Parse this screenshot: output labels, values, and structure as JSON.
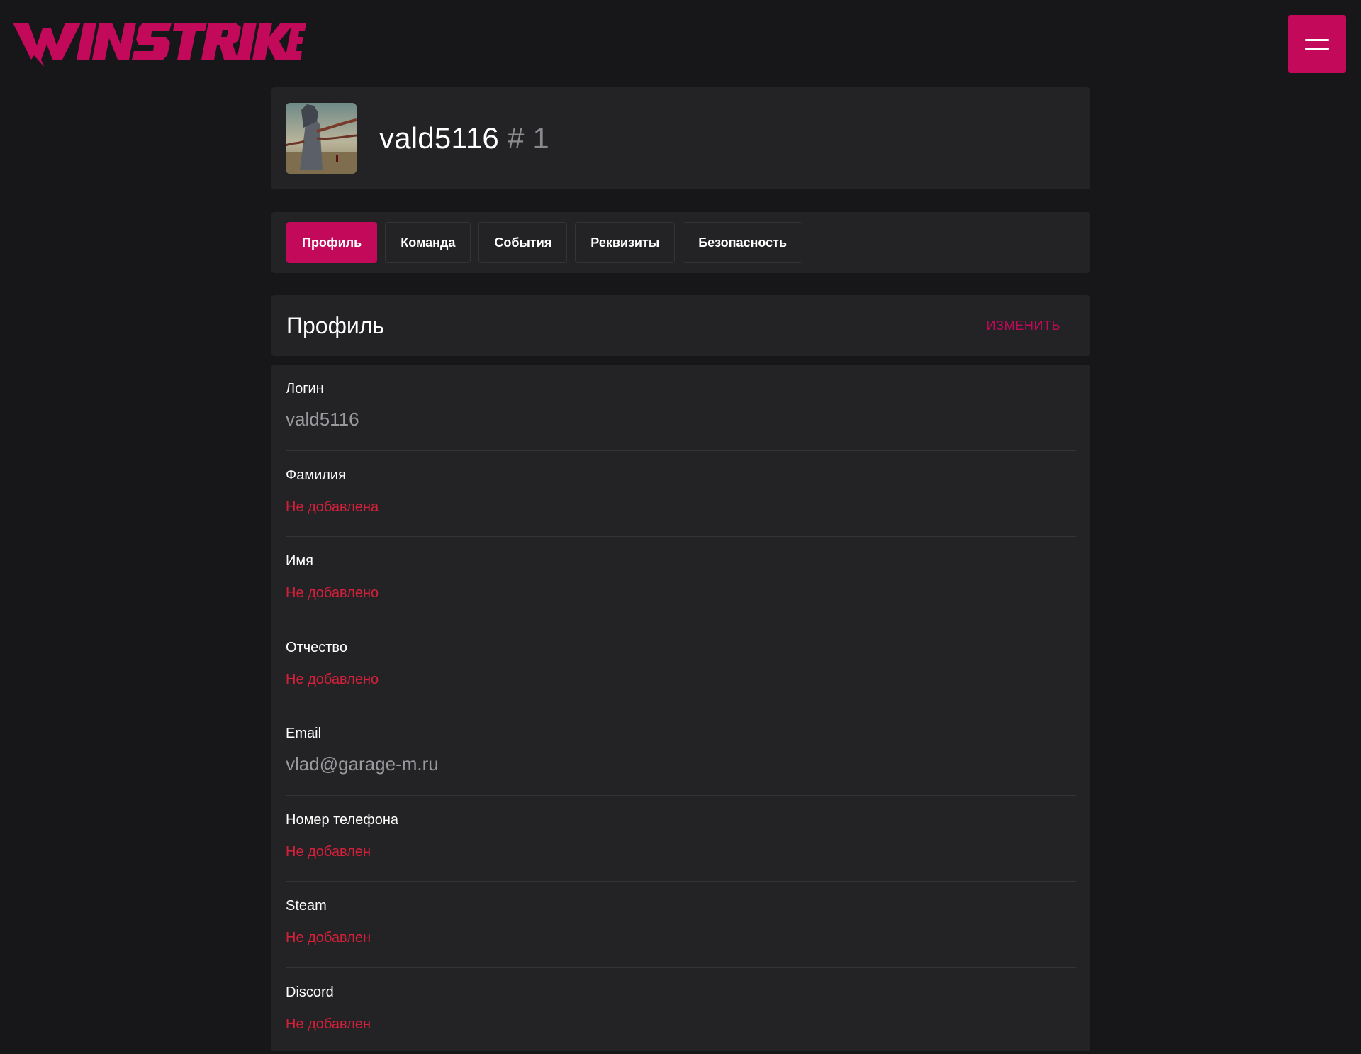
{
  "header": {
    "logo_text": "WINSTRIKE",
    "menu_icon": "hamburger-menu-icon",
    "accent_color": "#c2095a"
  },
  "user": {
    "username": "vald5116",
    "hash": "# 1",
    "avatar_icon": "user-avatar-image"
  },
  "tabs": [
    {
      "label": "Профиль",
      "active": true
    },
    {
      "label": "Команда",
      "active": false
    },
    {
      "label": "События",
      "active": false
    },
    {
      "label": "Реквизиты",
      "active": false
    },
    {
      "label": "Безопасность",
      "active": false
    }
  ],
  "section": {
    "title": "Профиль",
    "edit_label": "Изменить"
  },
  "fields": [
    {
      "label": "Логин",
      "value": "vald5116",
      "empty": false
    },
    {
      "label": "Фамилия",
      "value": "Не добавлена",
      "empty": true
    },
    {
      "label": "Имя",
      "value": "Не добавлено",
      "empty": true
    },
    {
      "label": "Отчество",
      "value": "Не добавлено",
      "empty": true
    },
    {
      "label": "Email",
      "value": "vlad@garage-m.ru",
      "empty": false
    },
    {
      "label": "Номер телефона",
      "value": "Не добавлен",
      "empty": true
    },
    {
      "label": "Steam",
      "value": "Не добавлен",
      "empty": true
    },
    {
      "label": "Discord",
      "value": "Не добавлен",
      "empty": true
    }
  ],
  "colors": {
    "background": "#17171a",
    "card": "#232325",
    "accent": "#c2095a",
    "error_text": "#d6203b",
    "muted_text": "#9a9a9e"
  }
}
